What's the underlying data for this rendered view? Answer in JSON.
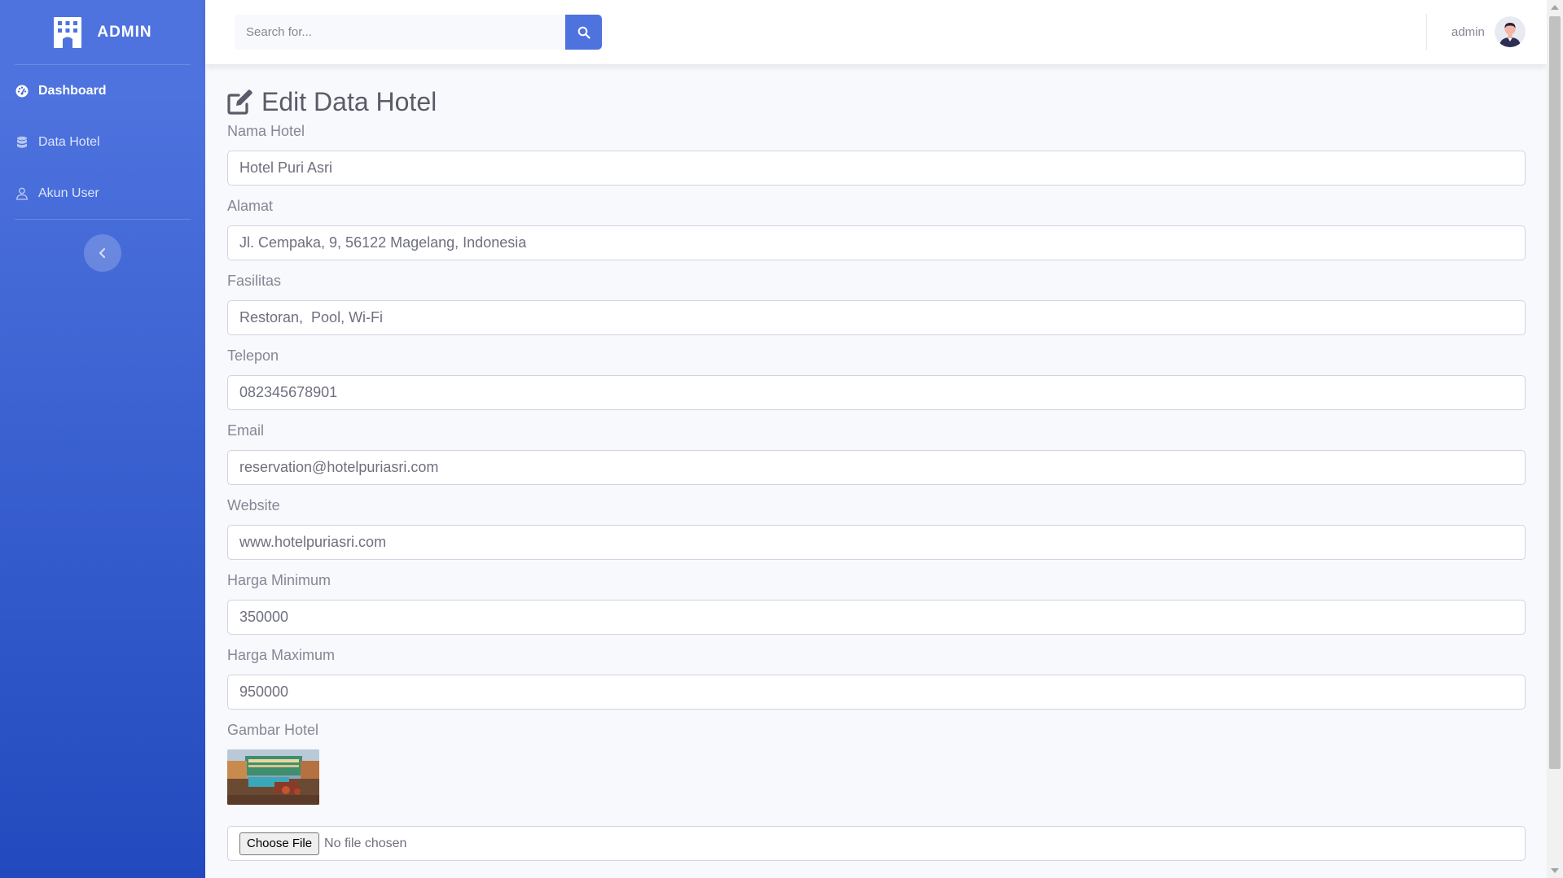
{
  "sidebar": {
    "brand": "ADMIN",
    "items": [
      {
        "label": "Dashboard",
        "icon": "tachometer-icon",
        "active": true
      },
      {
        "label": "Data Hotel",
        "icon": "database-icon",
        "active": false
      },
      {
        "label": "Akun User",
        "icon": "user-icon",
        "active": false
      }
    ],
    "toggle_icon": "chevron-left-icon"
  },
  "topbar": {
    "search_placeholder": "Search for...",
    "search_icon": "search-icon",
    "user_name": "admin"
  },
  "page": {
    "title": "Edit Data Hotel",
    "title_icon": "edit-icon"
  },
  "form": {
    "fields": [
      {
        "label": "Nama Hotel",
        "value": "Hotel Puri Asri"
      },
      {
        "label": "Alamat",
        "value": "Jl. Cempaka, 9, 56122 Magelang, Indonesia"
      },
      {
        "label": "Fasilitas",
        "value": "Restoran,  Pool, Wi-Fi"
      },
      {
        "label": "Telepon",
        "value": "082345678901"
      },
      {
        "label": "Email",
        "value": "reservation@hotelpuriasri.com"
      },
      {
        "label": "Website",
        "value": "www.hotelpuriasri.com"
      },
      {
        "label": "Harga Minimum",
        "value": "350000"
      },
      {
        "label": "Harga Maximum",
        "value": "950000"
      }
    ],
    "image_label": "Gambar Hotel",
    "file_button": "Choose File",
    "file_status": "No file chosen"
  },
  "colors": {
    "primary": "#4e73df",
    "sidebar_gradient_end": "#224abe",
    "background": "#f8f9fc",
    "text_muted": "#858796"
  }
}
